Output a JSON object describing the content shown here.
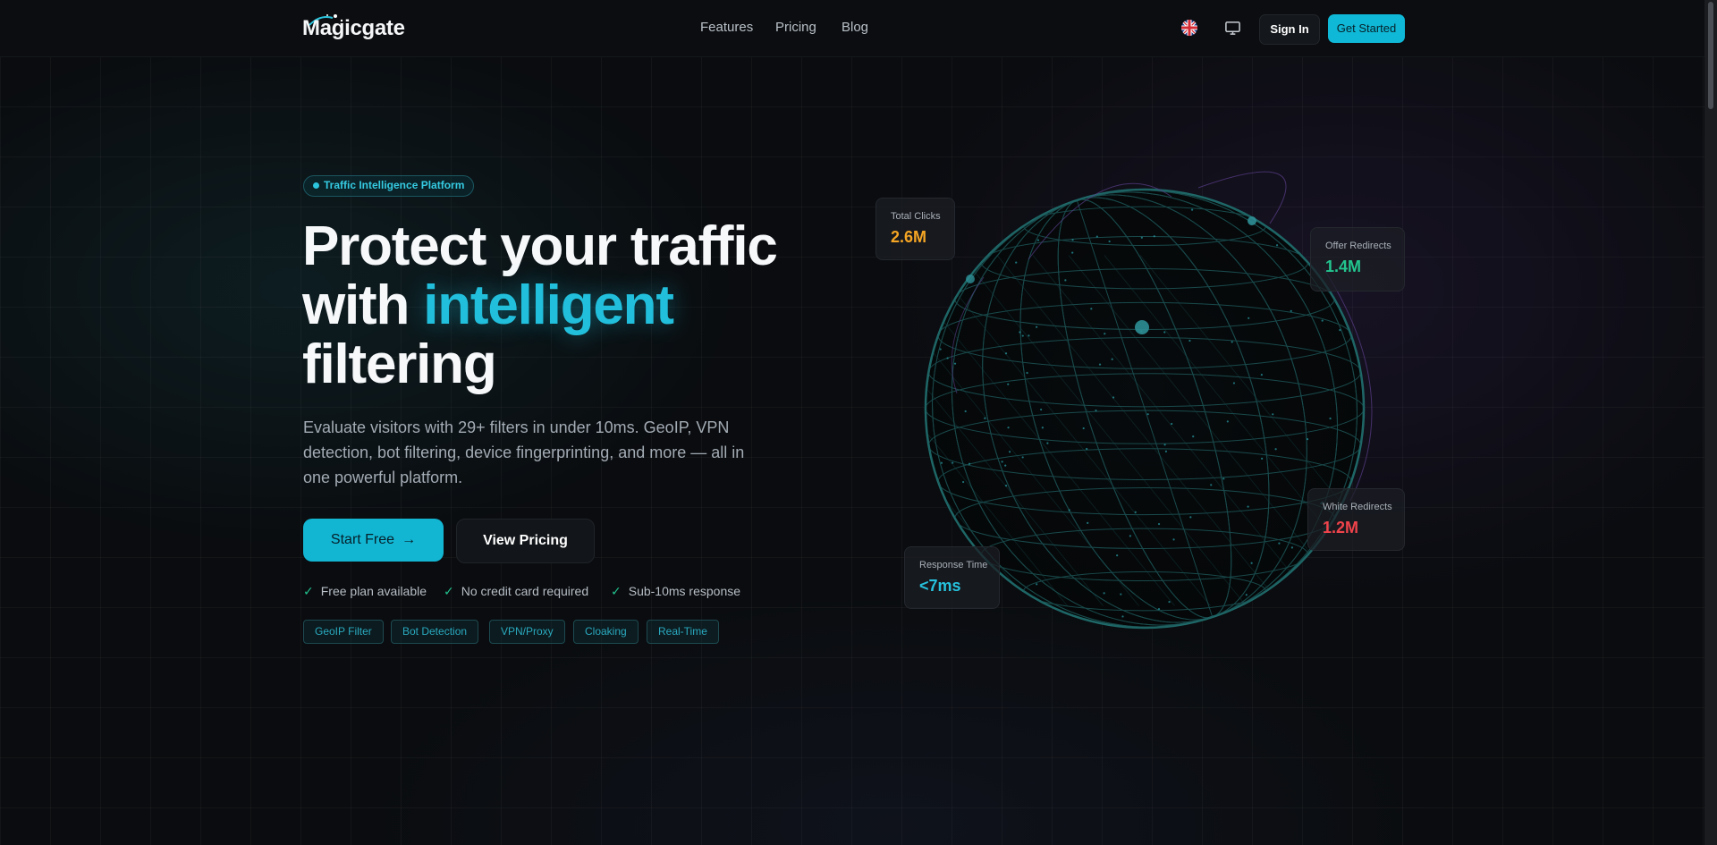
{
  "header": {
    "logo_text": "Magicgate",
    "nav": [
      "Features",
      "Pricing",
      "Blog"
    ],
    "language_icon": "uk-flag-icon",
    "theme_icon": "monitor-icon",
    "signin_label": "Sign In",
    "getstarted_label": "Get Started"
  },
  "hero": {
    "badge": "Traffic Intelligence Platform",
    "headline_part1": "Protect your traffic with",
    "headline_accent": "intelligent",
    "headline_part2": "filtering",
    "subtext": "Evaluate visitors with 29+ filters in under 10ms. GeoIP, VPN detection, bot filtering, device fingerprinting, and more — all in one powerful platform.",
    "start_label": "Start Free",
    "pricing_label": "View Pricing",
    "checks": [
      "Free plan available",
      "No credit card required",
      "Sub-10ms response"
    ],
    "tags": [
      "GeoIP Filter",
      "Bot Detection",
      "VPN/Proxy",
      "Cloaking",
      "Real-Time"
    ]
  },
  "stats": {
    "total_clicks": {
      "label": "Total Clicks",
      "value": "2.6M"
    },
    "offer_redirects": {
      "label": "Offer Redirects",
      "value": "1.4M"
    },
    "white_redirects": {
      "label": "White Redirects",
      "value": "1.2M"
    },
    "response_time": {
      "label": "Response Time",
      "value": "<7ms"
    }
  },
  "colors": {
    "accent": "#12b6d3",
    "orange": "#f5a524",
    "green": "#23c48e",
    "red": "#f0434b"
  }
}
